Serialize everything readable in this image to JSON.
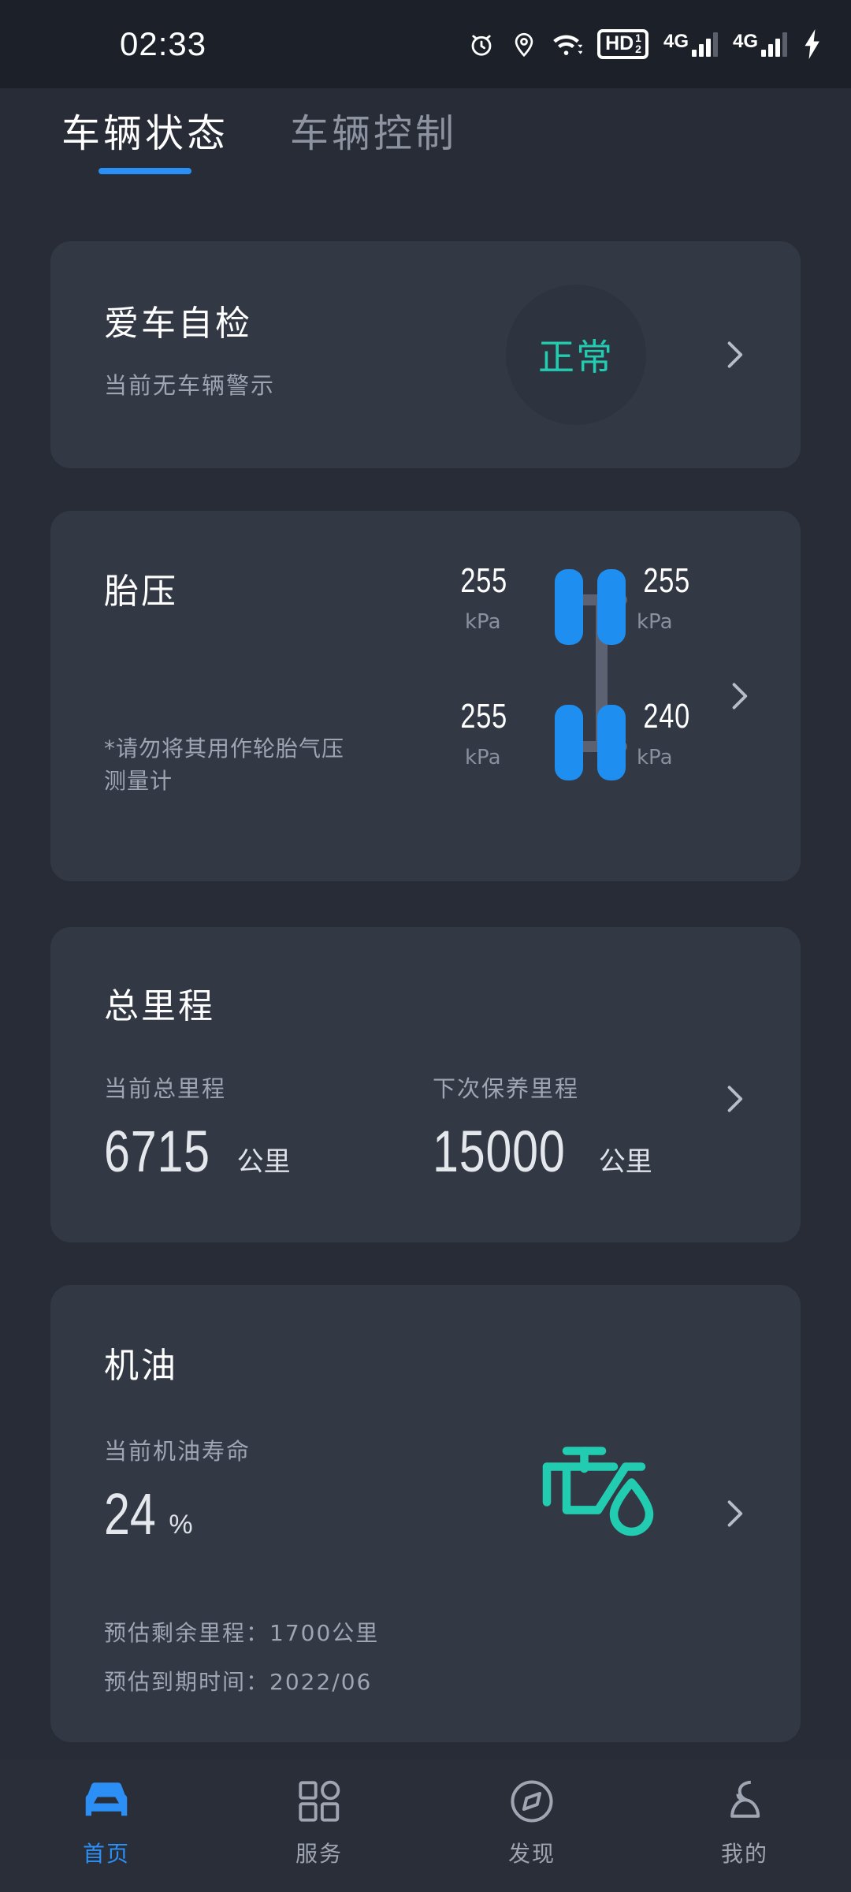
{
  "status_bar": {
    "time": "02:33",
    "icons": [
      "alarm-clock-icon",
      "location-pin-icon",
      "wifi-icon",
      "hd-volte-icon",
      "signal-4g-icon-1",
      "signal-4g-icon-2",
      "charging-bolt-icon"
    ],
    "hd_label": "HD",
    "hd_sup": "1",
    "hd_sub": "2",
    "network_label_1": "4G",
    "network_label_2": "4G"
  },
  "tabs": [
    {
      "label": "车辆状态",
      "active": true
    },
    {
      "label": "车辆控制",
      "active": false
    }
  ],
  "cards": {
    "self_check": {
      "title": "爱车自检",
      "subtitle": "当前无车辆警示",
      "status_badge": "正常",
      "status_color": "#22ccb0"
    },
    "tire_pressure": {
      "title": "胎压",
      "note": "*请勿将其用作轮胎气压测量计",
      "unit": "kPa",
      "tires": {
        "front_left": "255",
        "front_right": "255",
        "rear_left": "255",
        "rear_right": "240"
      },
      "tire_color": "#1e8ff0"
    },
    "mileage": {
      "title": "总里程",
      "current_label": "当前总里程",
      "current_value": "6715",
      "current_unit": "公里",
      "next_service_label": "下次保养里程",
      "next_service_value": "15000",
      "next_service_unit": "公里"
    },
    "oil": {
      "title": "机油",
      "life_label": "当前机油寿命",
      "life_value": "24",
      "life_unit": "%",
      "remaining_mileage": "预估剩余里程：1700公里",
      "expiry_date": "预估到期时间：2022/06",
      "icon": "oil-can-icon",
      "icon_color": "#22ccb0"
    }
  },
  "bottom_nav": [
    {
      "label": "首页",
      "icon": "car-front-icon",
      "active": true
    },
    {
      "label": "服务",
      "icon": "grid-icon",
      "active": false
    },
    {
      "label": "发现",
      "icon": "compass-icon",
      "active": false
    },
    {
      "label": "我的",
      "icon": "person-icon",
      "active": false
    }
  ],
  "theme": {
    "page_bg": "#282c36",
    "card_bg": "#333845",
    "accent_blue": "#2b8ff5",
    "accent_teal": "#22ccb0",
    "text_primary": "#ffffff",
    "text_secondary": "#9fa5b2"
  }
}
